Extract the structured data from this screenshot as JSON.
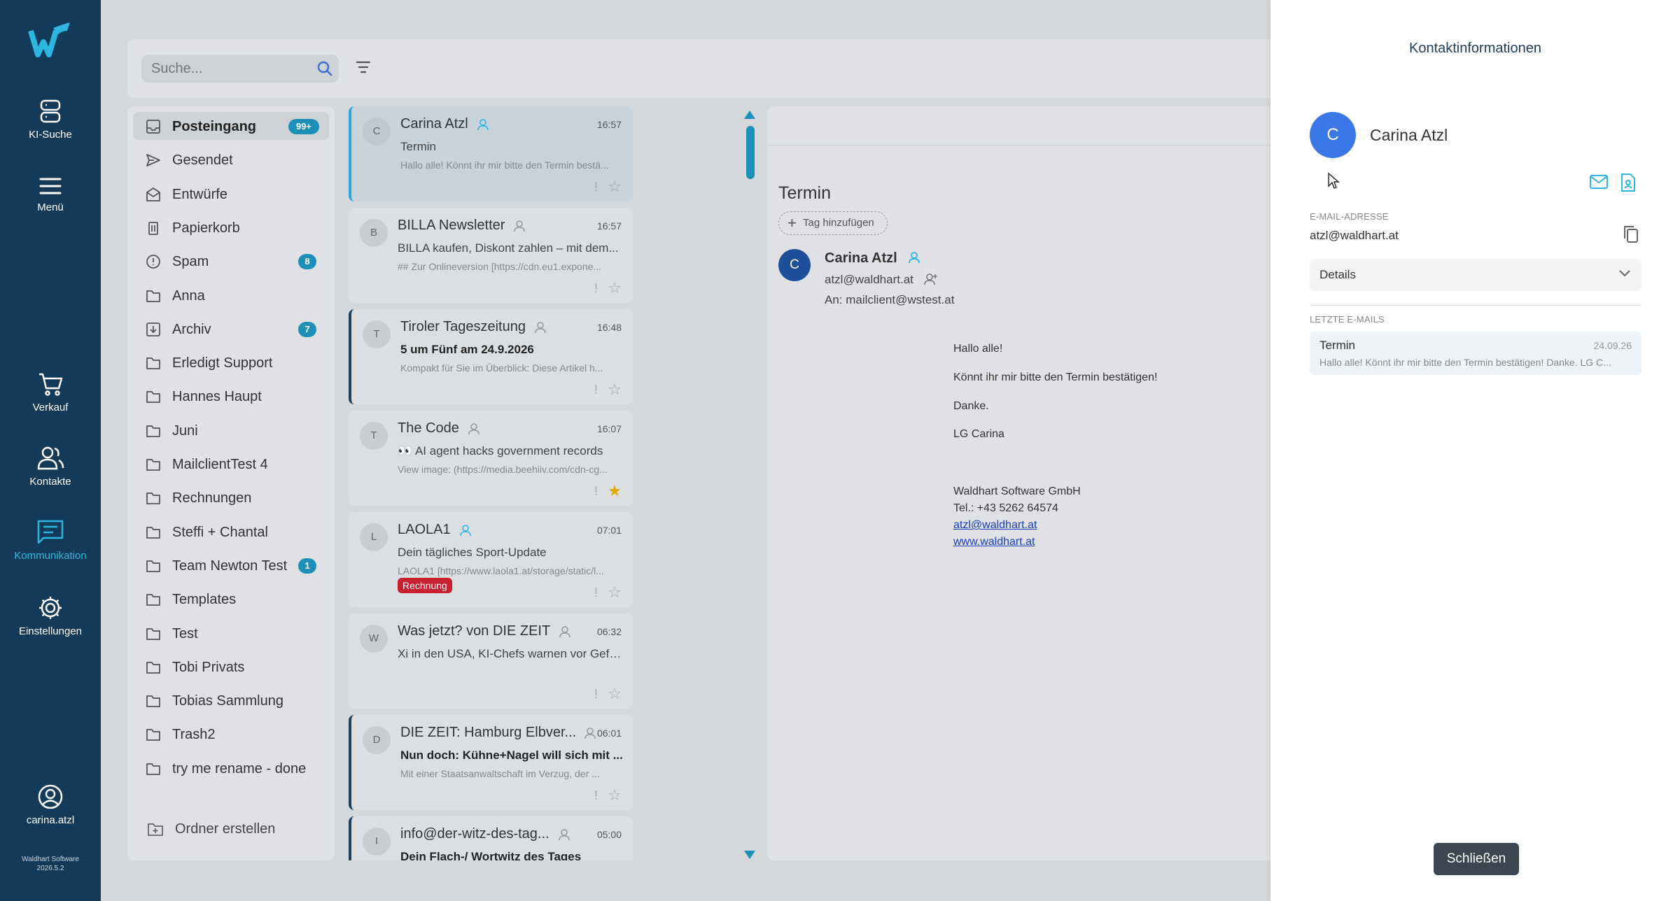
{
  "nav": {
    "items": [
      {
        "label": "KI-Suche",
        "icon": "database-icon"
      },
      {
        "label": "Menü",
        "icon": "menu-icon"
      },
      {
        "label": "Verkauf",
        "icon": "cart-icon"
      },
      {
        "label": "Kontakte",
        "icon": "contacts-icon"
      },
      {
        "label": "Kommunikation",
        "icon": "chat-icon",
        "active": true
      },
      {
        "label": "Einstellungen",
        "icon": "gear-icon"
      }
    ],
    "user": "carina.atzl",
    "version_line1": "Waldhart Software",
    "version_line2": "2026.5.2",
    "accent_color": "#2db7e0",
    "background_color": "#133b59"
  },
  "search": {
    "placeholder": "Suche..."
  },
  "folders": [
    {
      "name": "Posteingang",
      "badge": "99+",
      "icon": "inbox-icon",
      "active": true
    },
    {
      "name": "Gesendet",
      "badge": "",
      "icon": "send-icon"
    },
    {
      "name": "Entwürfe",
      "badge": "",
      "icon": "drafts-icon"
    },
    {
      "name": "Papierkorb",
      "badge": "",
      "icon": "trash-icon"
    },
    {
      "name": "Spam",
      "badge": "8",
      "icon": "spam-icon"
    },
    {
      "name": "Anna",
      "badge": "",
      "icon": "folder-icon"
    },
    {
      "name": "Archiv",
      "badge": "7",
      "icon": "archive-icon"
    },
    {
      "name": "Erledigt Support",
      "badge": "",
      "icon": "folder-icon"
    },
    {
      "name": "Hannes Haupt",
      "badge": "",
      "icon": "folder-icon"
    },
    {
      "name": "Juni",
      "badge": "",
      "icon": "folder-icon"
    },
    {
      "name": "MailclientTest 4",
      "badge": "",
      "icon": "folder-icon"
    },
    {
      "name": "Rechnungen",
      "badge": "",
      "icon": "folder-icon"
    },
    {
      "name": "Steffi + Chantal",
      "badge": "",
      "icon": "folder-icon"
    },
    {
      "name": "Team Newton Test",
      "badge": "1",
      "icon": "folder-icon"
    },
    {
      "name": "Templates",
      "badge": "",
      "icon": "folder-icon"
    },
    {
      "name": "Test",
      "badge": "",
      "icon": "folder-icon"
    },
    {
      "name": "Tobi Privats",
      "badge": "",
      "icon": "folder-icon"
    },
    {
      "name": "Tobias Sammlung",
      "badge": "",
      "icon": "folder-icon"
    },
    {
      "name": "Trash2",
      "badge": "",
      "icon": "folder-icon"
    },
    {
      "name": "try me rename - done",
      "badge": "",
      "icon": "folder-icon"
    }
  ],
  "create_folder_label": "Ordner erstellen",
  "mails": [
    {
      "avatar": "C",
      "from": "Carina Atzl",
      "time": "16:57",
      "subject": "Termin",
      "preview": "Hallo alle! Könnt ihr mir bitte den Termin bestä...",
      "bold": false,
      "starred": false,
      "selected": true,
      "bar": false,
      "tag": ""
    },
    {
      "avatar": "B",
      "from": "BILLA Newsletter",
      "time": "16:57",
      "subject": "BILLA kaufen, Diskont zahlen – mit dem...",
      "preview": "## Zur Onlineversion [https://cdn.eu1.expone...",
      "bold": false,
      "starred": false,
      "selected": false,
      "bar": false,
      "tag": ""
    },
    {
      "avatar": "T",
      "from": "Tiroler Tageszeitung",
      "time": "16:48",
      "subject": "5 um Fünf am 24.9.2026",
      "preview": "Kompakt für Sie im Überblick: Diese Artikel h...",
      "bold": true,
      "starred": false,
      "selected": false,
      "bar": true,
      "tag": ""
    },
    {
      "avatar": "T",
      "from": "The Code",
      "time": "16:07",
      "subject": "👀 AI agent hacks government records",
      "preview": "View image: (https://media.beehiiv.com/cdn-cg...",
      "bold": false,
      "starred": true,
      "selected": false,
      "bar": false,
      "tag": ""
    },
    {
      "avatar": "L",
      "from": "LAOLA1",
      "time": "07:01",
      "subject": "Dein tägliches Sport-Update",
      "preview": "LAOLA1 [https://www.laola1.at/storage/static/l...",
      "bold": false,
      "starred": false,
      "selected": false,
      "bar": false,
      "tag": "Rechnung"
    },
    {
      "avatar": "W",
      "from": "Was jetzt? von DIE ZEIT",
      "time": "06:32",
      "subject": "Xi in den USA, KI-Chefs warnen vor Gefa...",
      "preview": "",
      "bold": false,
      "starred": false,
      "selected": false,
      "bar": false,
      "tag": ""
    },
    {
      "avatar": "D",
      "from": "DIE ZEIT: Hamburg Elbver...",
      "time": "06:01",
      "subject": "Nun doch: Kühne+Nagel will sich mit ...",
      "preview": "Mit einer Staatsanwaltschaft im Verzug, der ...",
      "bold": true,
      "starred": false,
      "selected": false,
      "bar": true,
      "tag": ""
    },
    {
      "avatar": "I",
      "from": "info@der-witz-des-tag...",
      "time": "05:00",
      "subject": "Dein Flach-/ Wortwitz des Tages",
      "preview": "",
      "bold": true,
      "starred": false,
      "selected": false,
      "bar": true,
      "tag": ""
    }
  ],
  "reader": {
    "subject": "Termin",
    "tag_button": "Tag hinzufügen",
    "sender_avatar": "C",
    "sender_name": "Carina Atzl",
    "sender_email": "atzl@waldhart.at",
    "to": "An: mailclient@wstest.at",
    "body": [
      "Hallo alle!",
      "Könnt ihr mir bitte den Termin bestätigen!",
      "Danke.",
      "LG Carina",
      "Waldhart Software GmbH",
      "Tel.: +43 5262 64574"
    ],
    "link_email": "atzl@waldhart.at",
    "link_web": "www.waldhart.at"
  },
  "contact_panel": {
    "title": "Kontaktinformationen",
    "avatar": "C",
    "name": "Carina Atzl",
    "email_label": "E-MAIL-ADRESSE",
    "email": "atzl@waldhart.at",
    "details_label": "Details",
    "recent_label": "LETZTE E-MAILS",
    "recent": {
      "subject": "Termin",
      "date": "24.09.26",
      "preview": "Hallo alle! Könnt ihr mir bitte den Termin bestätigen! Danke. LG C..."
    },
    "close_label": "Schließen"
  }
}
